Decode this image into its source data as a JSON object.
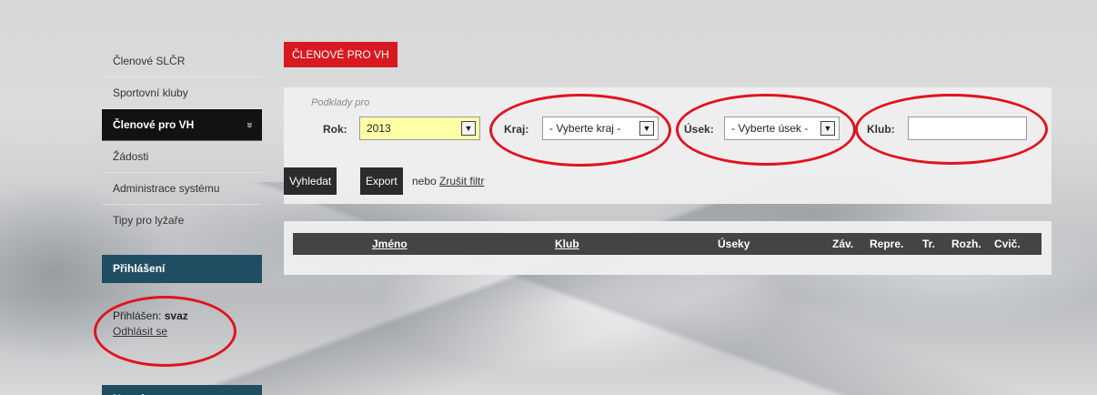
{
  "sidebar": {
    "items": [
      {
        "label": "Členové SLČR"
      },
      {
        "label": "Sportovní kluby"
      },
      {
        "label": "Členové pro VH"
      },
      {
        "label": "Žádosti"
      },
      {
        "label": "Administrace systému"
      },
      {
        "label": "Tipy pro lyžaře"
      }
    ],
    "active_chevron": "»",
    "login_header": "Přihlášení",
    "logged_in_label": "Přihlášen:",
    "logged_in_user": "svaz",
    "logout_link": "Odhlásit se",
    "newsletter_header": "Newsletter"
  },
  "page": {
    "tab_title": "ČLENOVÉ PRO VH"
  },
  "filters": {
    "legend": "Podklady pro",
    "rok_label": "Rok:",
    "rok_value": "2013",
    "kraj_label": "Kraj:",
    "kraj_value": "- Vyberte kraj -",
    "usek_label": "Úsek:",
    "usek_value": "- Vyberte úsek -",
    "klub_label": "Klub:",
    "klub_value": "",
    "search_button": "Vyhledat",
    "export_button": "Export",
    "or_text": "nebo",
    "clear_filter_link": "Zrušit filtr"
  },
  "table": {
    "columns": [
      "Jméno",
      "Klub",
      "Úseky",
      "Záv.",
      "Repre.",
      "Tr.",
      "Rozh.",
      "Cvič."
    ]
  },
  "colors": {
    "accent_red": "#d81920",
    "sidebar_header": "#1f4e63",
    "annotation_red": "#e0141e",
    "year_highlight": "#ffffa8"
  }
}
